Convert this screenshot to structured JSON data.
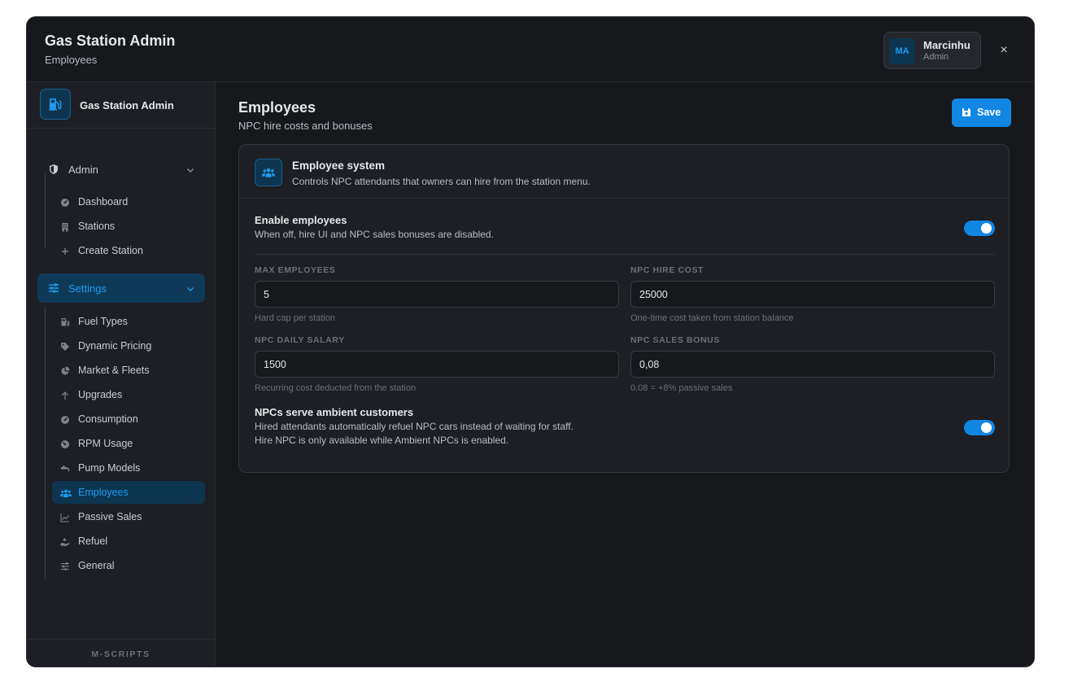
{
  "header": {
    "title": "Gas Station Admin",
    "subtitle": "Employees",
    "user": {
      "initials": "MA",
      "name": "Marcinhu",
      "role": "Admin"
    },
    "close_label": "×"
  },
  "sidebar": {
    "brand_title": "Gas Station Admin",
    "groups": [
      {
        "label": "Admin",
        "items": [
          {
            "label": "Dashboard",
            "icon": "gauge-icon"
          },
          {
            "label": "Stations",
            "icon": "building-icon"
          },
          {
            "label": "Create Station",
            "icon": "plus-icon"
          }
        ]
      },
      {
        "label": "Settings",
        "items": [
          {
            "label": "Fuel Types",
            "icon": "gas-pump-icon"
          },
          {
            "label": "Dynamic Pricing",
            "icon": "tags-icon"
          },
          {
            "label": "Market & Fleets",
            "icon": "pie-chart-icon"
          },
          {
            "label": "Upgrades",
            "icon": "arrow-up-icon"
          },
          {
            "label": "Consumption",
            "icon": "gauge-icon"
          },
          {
            "label": "RPM Usage",
            "icon": "gauge-icon"
          },
          {
            "label": "Pump Models",
            "icon": "faucet-icon"
          },
          {
            "label": "Employees",
            "icon": "users-icon",
            "active": true
          },
          {
            "label": "Passive Sales",
            "icon": "line-chart-icon"
          },
          {
            "label": "Refuel",
            "icon": "hand-icon"
          },
          {
            "label": "General",
            "icon": "sliders-icon"
          }
        ]
      }
    ],
    "footer": "M-SCRIPTS"
  },
  "main": {
    "title": "Employees",
    "subtitle": "NPC hire costs and bonuses",
    "save_label": "Save",
    "card": {
      "title": "Employee system",
      "description": "Controls NPC attendants that owners can hire from the station menu.",
      "enable": {
        "title": "Enable employees",
        "description": "When off, hire UI and NPC sales bonuses are disabled.",
        "on": true
      },
      "fields": [
        {
          "label": "MAX EMPLOYEES",
          "value": "5",
          "help": "Hard cap per station"
        },
        {
          "label": "NPC HIRE COST",
          "value": "25000",
          "help": "One-time cost taken from station balance"
        },
        {
          "label": "NPC DAILY SALARY",
          "value": "1500",
          "help": "Recurring cost deducted from the station"
        },
        {
          "label": "NPC SALES BONUS",
          "value": "0,08",
          "help": "0.08 = +8% passive sales"
        }
      ],
      "ambient": {
        "title": "NPCs serve ambient customers",
        "description_line1": "Hired attendants automatically refuel NPC cars instead of waiting for staff.",
        "description_line2": "Hire NPC is only available while Ambient NPCs is enabled.",
        "on": true
      }
    }
  },
  "colors": {
    "accent": "#1186e3",
    "accent_text": "#1d9bf0",
    "background": "#16181c",
    "panel": "#1d1f24"
  }
}
